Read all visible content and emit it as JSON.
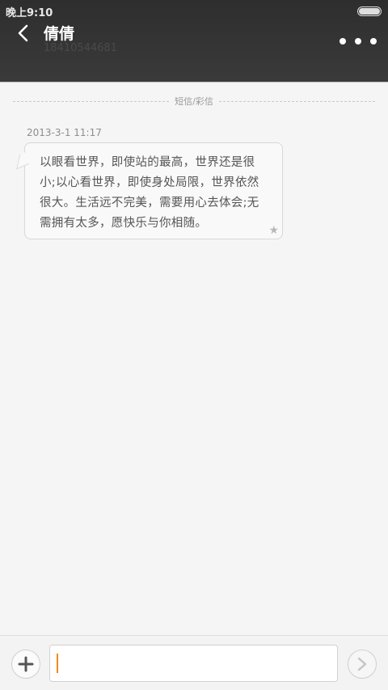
{
  "status_bar": {
    "time": "晚上9:10"
  },
  "header": {
    "contact_name": "倩倩",
    "contact_number": "18410544681"
  },
  "conversation": {
    "channel_label": "短信/彩信",
    "messages": [
      {
        "timestamp": "2013-3-1 11:17",
        "text": "以眼看世界，即使站的最高，世界还是很小;以心看世界，即使身处局限，世界依然很大。生活远不完美，需要用心去体会;无需拥有太多，愿快乐与你相随。",
        "starred": false
      }
    ]
  },
  "composer": {
    "input_value": "",
    "placeholder": ""
  },
  "colors": {
    "header_bg": "#353535",
    "page_bg": "#f5f5f5",
    "cursor": "#f2871e"
  }
}
